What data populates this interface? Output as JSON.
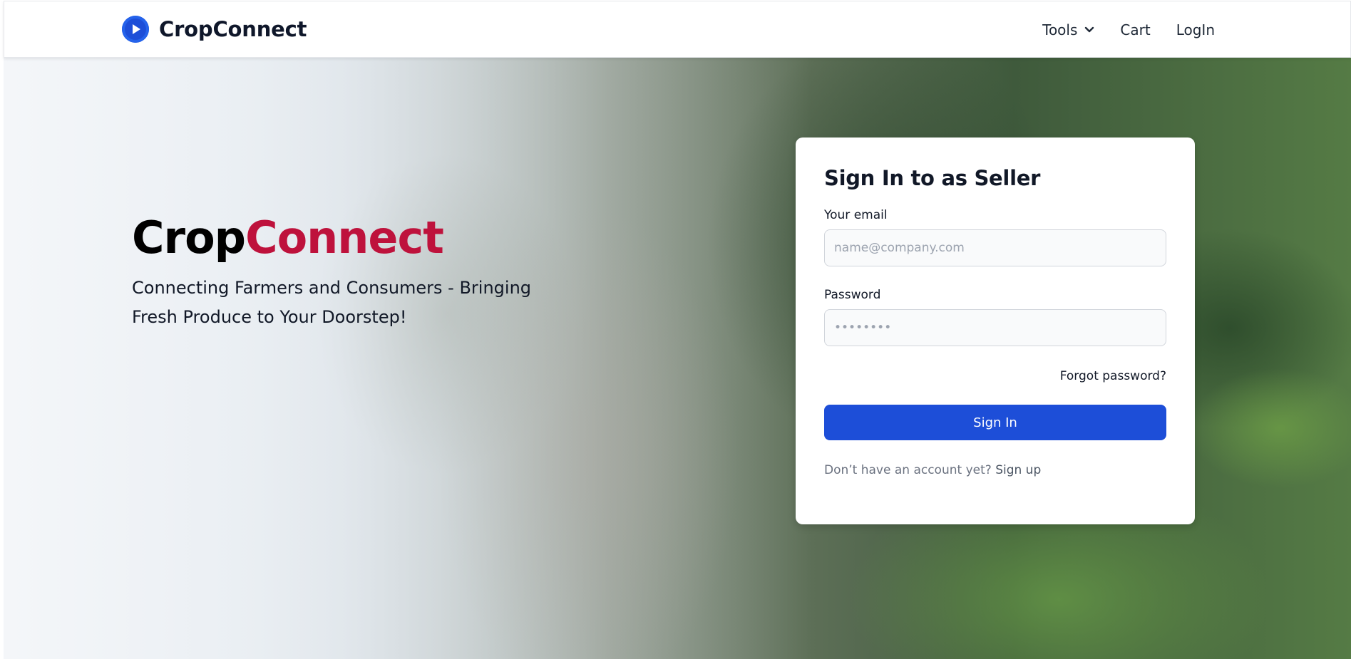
{
  "nav": {
    "brand": "CropConnect",
    "tools_label": "Tools",
    "cart_label": "Cart",
    "login_label": "LogIn"
  },
  "hero": {
    "title_part1": "Crop",
    "title_part2": "Connect",
    "tagline": "Connecting Farmers and Consumers - Bringing Fresh Produce to Your Doorstep!"
  },
  "signin": {
    "title": "Sign In to as Seller",
    "email_label": "Your email",
    "email_placeholder": "name@company.com",
    "password_label": "Password",
    "password_placeholder": "••••••••",
    "forgot_label": "Forgot password?",
    "submit_label": "Sign In",
    "no_account_text": "Don’t have an account yet? ",
    "signup_label": "Sign up"
  },
  "colors": {
    "primary": "#1d4ed8",
    "accent": "#be123c",
    "text_dark": "#111827"
  },
  "icons": {
    "logo": "play-circle-icon",
    "tools_dropdown": "chevron-down-icon"
  }
}
